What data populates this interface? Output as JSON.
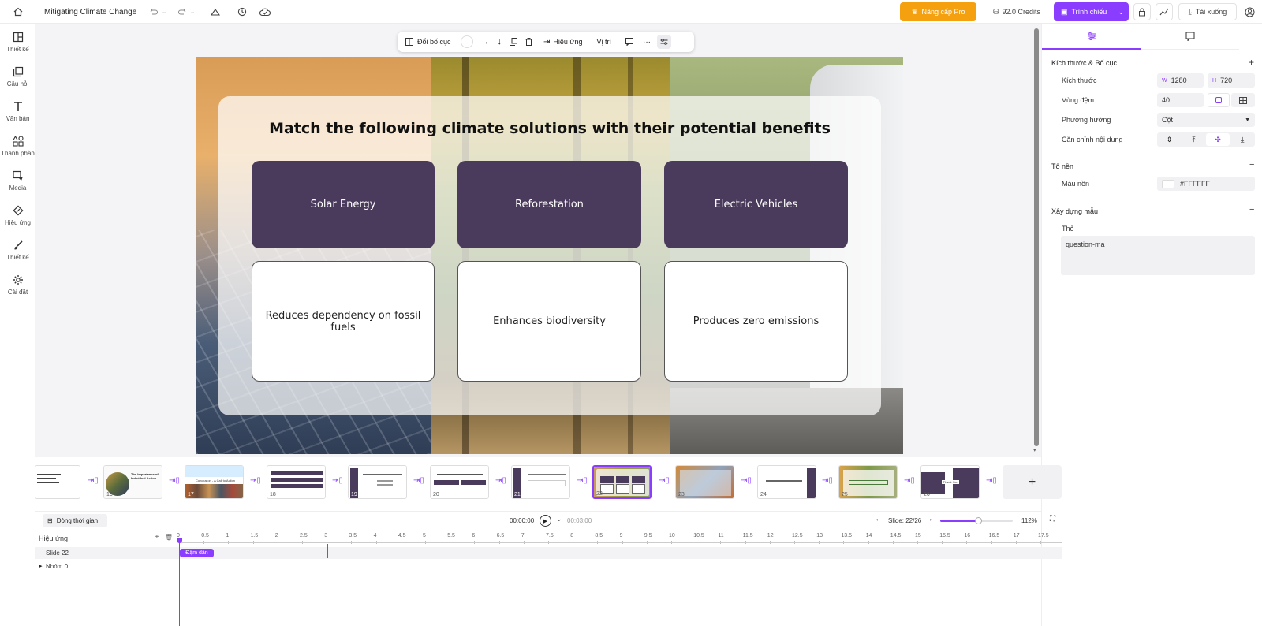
{
  "header": {
    "doc_title": "Mitigating Climate Change",
    "upgrade_label": "Nâng cấp Pro",
    "credits_label": "92.0 Credits",
    "present_label": "Trình chiếu",
    "download_label": "Tải xuống"
  },
  "sidebar": {
    "items": [
      {
        "label": "Thiết kế",
        "icon": "layout-icon"
      },
      {
        "label": "Câu hỏi",
        "icon": "question-icon"
      },
      {
        "label": "Văn bản",
        "icon": "text-icon"
      },
      {
        "label": "Thành phần",
        "icon": "components-icon"
      },
      {
        "label": "Media",
        "icon": "media-icon"
      },
      {
        "label": "Hiệu ứng",
        "icon": "effects-icon"
      },
      {
        "label": "Thiết kế",
        "icon": "brush-icon"
      },
      {
        "label": "Cài đặt",
        "icon": "settings-icon"
      }
    ]
  },
  "toolbar": {
    "change_layout_label": "Đổi bố cục",
    "effects_label": "Hiệu ứng",
    "position_label": "Vị trí"
  },
  "slide": {
    "title": "Match the following climate solutions with their potential benefits",
    "top_cards": [
      "Solar Energy",
      "Reforestation",
      "Electric Vehicles"
    ],
    "bottom_cards": [
      "Reduces dependency on fossil fuels",
      "Enhances biodiversity",
      "Produces zero emissions"
    ],
    "colors": {
      "card_dark": "#4a3a5c",
      "accent": "#8b3dff",
      "upgrade": "#f5a00f"
    }
  },
  "panel": {
    "section_size": "Kích thước & Bố cục",
    "size_label": "Kích thước",
    "width_prefix": "W",
    "width_value": "1280",
    "height_prefix": "H",
    "height_value": "720",
    "padding_label": "Vùng đệm",
    "padding_value": "40",
    "direction_label": "Phương hướng",
    "direction_value": "Cột",
    "align_label": "Căn chỉnh nội dung",
    "section_bg": "Tô nền",
    "bg_color_label": "Màu nền",
    "bg_color_value": "#FFFFFF",
    "section_template": "Xây dựng mẫu",
    "tag_label": "Thẻ",
    "tag_value": "question-ma"
  },
  "filmstrip": {
    "numbers": [
      "16",
      "17",
      "18",
      "19",
      "20",
      "21",
      "22",
      "23",
      "24",
      "25",
      "26"
    ],
    "thumb1_text": "The Importance of Individual Action",
    "thumb2_text": "Conclusion - A Call to Action",
    "thumb_last_text": "Thank You"
  },
  "timeline": {
    "timeline_label": "Dòng thời gian",
    "current_time": "00:00:00",
    "total_time": "00:03:00",
    "slide_indicator": "Slide: 22/26",
    "zoom": "112%",
    "effects_label": "Hiệu ứng",
    "slide_row": "Slide 22",
    "group_row": "Nhóm 0",
    "effect_chip": "Đậm dần",
    "ticks": [
      "0",
      "0.5",
      "1",
      "1.5",
      "2",
      "2.5",
      "3",
      "3.5",
      "4",
      "4.5",
      "5",
      "5.5",
      "6",
      "6.5",
      "7",
      "7.5",
      "8",
      "8.5",
      "9",
      "9.5",
      "10",
      "10.5",
      "11",
      "11.5",
      "12",
      "12.5",
      "13",
      "13.5",
      "14",
      "14.5",
      "15",
      "15.5",
      "16",
      "16.5",
      "17",
      "17.5"
    ]
  }
}
